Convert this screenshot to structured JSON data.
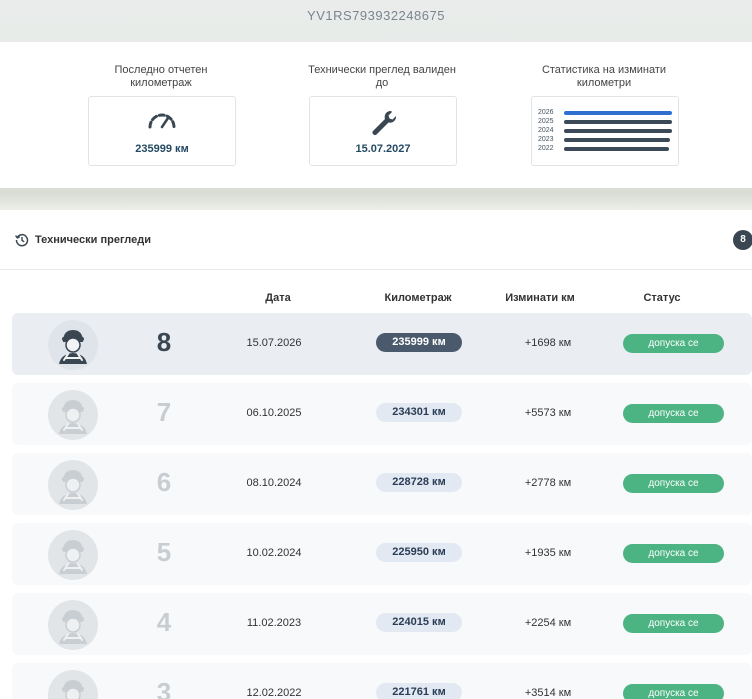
{
  "vehicle": {
    "vin": "YV1RS793932248675"
  },
  "info": {
    "mileage": {
      "label": "Последно отчетен километраж",
      "value": "235999 км",
      "icon": "speedometer-icon"
    },
    "inspection": {
      "label": "Технически преглед валиден до",
      "value": "15.07.2027",
      "icon": "wrench-icon"
    },
    "stats": {
      "label": "Статистика на изминати километри",
      "rows": [
        {
          "year": "2026",
          "fraction": 1.0,
          "highlight": true
        },
        {
          "year": "2025",
          "fraction": 1.0,
          "highlight": false
        },
        {
          "year": "2024",
          "fraction": 1.0,
          "highlight": false
        },
        {
          "year": "2023",
          "fraction": 0.98,
          "highlight": false
        },
        {
          "year": "2022",
          "fraction": 0.97,
          "highlight": false
        }
      ]
    }
  },
  "section": {
    "title": "Технически прегледи",
    "count": "8",
    "icon": "history-icon"
  },
  "table": {
    "headers": {
      "date": "Дата",
      "km": "Километраж",
      "diff": "Изминати км",
      "status": "Статус"
    },
    "rows": [
      {
        "num": "8",
        "date": "15.07.2026",
        "km": "235999 км",
        "diff": "+1698 км",
        "status": "допуска се",
        "active": true
      },
      {
        "num": "7",
        "date": "06.10.2025",
        "km": "234301 км",
        "diff": "+5573 км",
        "status": "допуска се",
        "active": false
      },
      {
        "num": "6",
        "date": "08.10.2024",
        "km": "228728 км",
        "diff": "+2778 км",
        "status": "допуска се",
        "active": false
      },
      {
        "num": "5",
        "date": "10.02.2024",
        "km": "225950 км",
        "diff": "+1935 км",
        "status": "допуска се",
        "active": false
      },
      {
        "num": "4",
        "date": "11.02.2023",
        "km": "224015 км",
        "diff": "+2254 км",
        "status": "допуска се",
        "active": false
      },
      {
        "num": "3",
        "date": "12.02.2022",
        "km": "221761 км",
        "diff": "+3514 км",
        "status": "допуска се",
        "active": false
      }
    ]
  },
  "colors": {
    "status_ok": "#4cb383",
    "badge_dark": "#3a4651",
    "highlight_bar": "#2f6fd1"
  }
}
